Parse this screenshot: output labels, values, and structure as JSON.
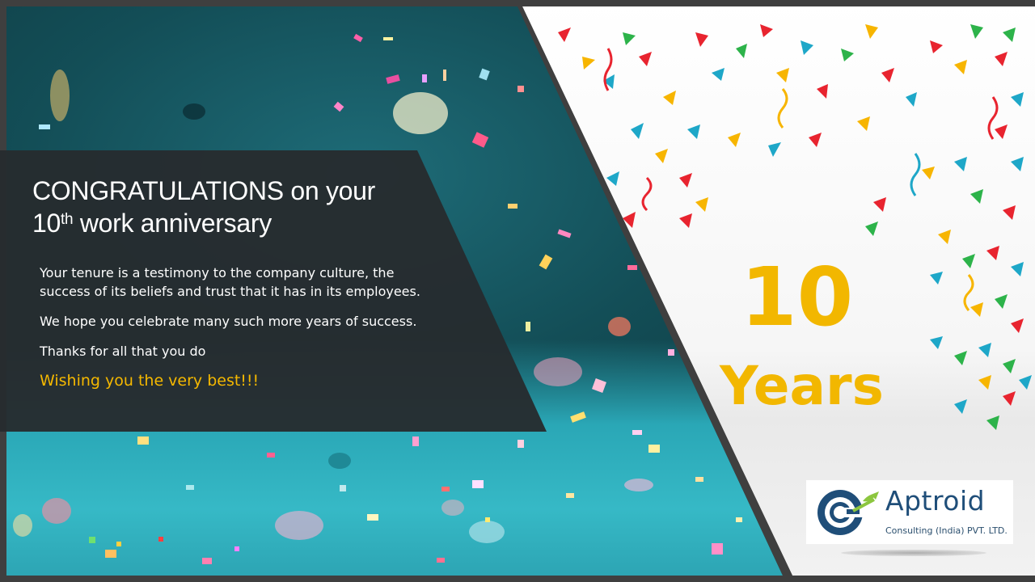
{
  "headline": {
    "part1": "CONGRATULATIONS on your",
    "number": "10",
    "suffix": "th",
    "part2": "work anniversary"
  },
  "body": {
    "line1a": "Your tenure is a testimony to the company culture, the",
    "line1b": "success of its beliefs and trust that it has in its employees.",
    "line2": "We hope you celebrate many such more years of success.",
    "line3": "Thanks for all that you do",
    "wish": "Wishing you the very best!!!"
  },
  "milestone": {
    "number": "10",
    "label": "Years"
  },
  "logo": {
    "name": "Aptroid",
    "subtitle": "Consulting (India) PVT. LTD."
  },
  "colors": {
    "accent_gold": "#f2b700",
    "logo_blue": "#1f4e79",
    "logo_green": "#8cc63f",
    "panel_dark": "#262c2f",
    "teal": "#2aa7b6"
  }
}
